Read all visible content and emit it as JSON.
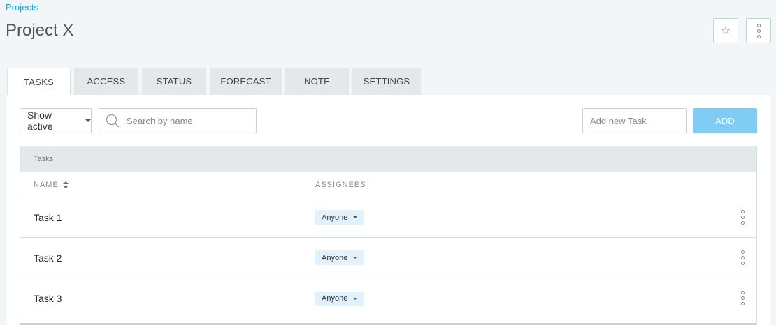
{
  "header": {
    "breadcrumb": "Projects",
    "title": "Project X",
    "favorite_icon": "star-icon",
    "more_icon": "vertical-dots-icon"
  },
  "tabs": [
    {
      "label": "TASKS",
      "active": true
    },
    {
      "label": "ACCESS",
      "active": false
    },
    {
      "label": "STATUS",
      "active": false
    },
    {
      "label": "FORECAST",
      "active": false
    },
    {
      "label": "NOTE",
      "active": false
    },
    {
      "label": "SETTINGS",
      "active": false
    }
  ],
  "toolbar": {
    "filter_value": "Show active",
    "search_placeholder": "Search by name",
    "new_task_placeholder": "Add new Task",
    "add_label": "ADD"
  },
  "table": {
    "title": "Tasks",
    "columns": {
      "name": "NAME",
      "assignees": "ASSIGNEES"
    },
    "rows": [
      {
        "name": "Task 1",
        "assignee": "Anyone"
      },
      {
        "name": "Task 2",
        "assignee": "Anyone"
      },
      {
        "name": "Task 3",
        "assignee": "Anyone"
      }
    ]
  },
  "colors": {
    "accent": "#03a9f4",
    "add_button": "#80ccf5",
    "background": "#f2f6f8",
    "assignee_chip": "#e1f2fc"
  }
}
